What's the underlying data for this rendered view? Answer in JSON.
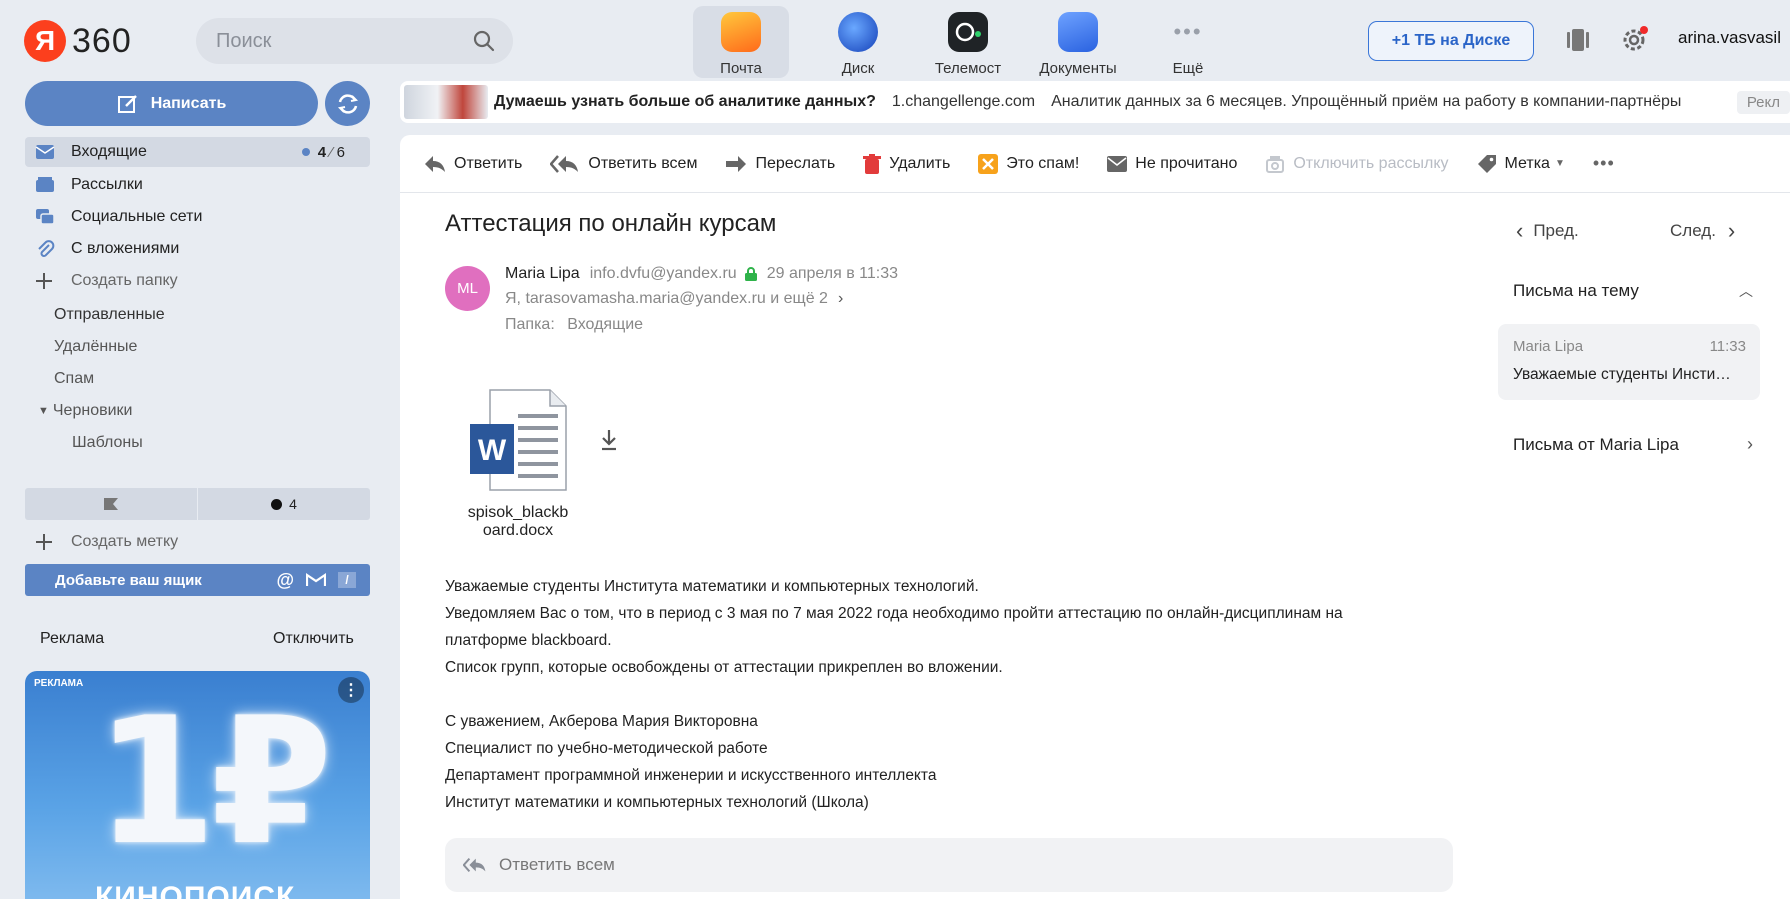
{
  "header": {
    "logo_letter": "Я",
    "logo_text": "360",
    "search_placeholder": "Поиск",
    "apps": [
      {
        "label": "Почта",
        "color": "#ff9f1a"
      },
      {
        "label": "Диск",
        "color": "#1e5bd8"
      },
      {
        "label": "Телемост",
        "color": "#1f2326"
      },
      {
        "label": "Документы",
        "color": "#3d7ef2"
      },
      {
        "label": "Ещё",
        "color": "#9aa0aa"
      }
    ],
    "storage_button": "+1 ТБ на Диске",
    "username": "arina.vasvasil"
  },
  "sidebar": {
    "compose_label": "Написать",
    "folders": [
      {
        "label": "Входящие",
        "count_unread": "4",
        "count_sep": "⁄",
        "count_total": "6"
      },
      {
        "label": "Рассылки"
      },
      {
        "label": "Социальные сети"
      },
      {
        "label": "С вложениями"
      },
      {
        "label": "Создать папку"
      }
    ],
    "subfolders": [
      "Отправленные",
      "Удалённые",
      "Спам",
      "Черновики",
      "Шаблоны"
    ],
    "labels_count": "4",
    "create_label": "Создать метку",
    "add_mailbox": "Добавьте ваш ящик",
    "ads_title": "Реклама",
    "ads_off": "Отключить",
    "ad_card_tag": "РЕКЛАМА",
    "ad_card_big": "1₽",
    "ad_card_text": "КИНОПОИСК"
  },
  "ad_banner": {
    "title": "Думаешь узнать больше об аналитике данных?",
    "domain": "1.changellenge.com",
    "text": "Аналитик данных за 6 месяцев. Упрощённый приём на работу в компании-партнёры",
    "tag": "Рекл"
  },
  "toolbar": {
    "reply": "Ответить",
    "reply_all": "Ответить всем",
    "forward": "Переслать",
    "delete": "Удалить",
    "spam": "Это спам!",
    "unread": "Не прочитано",
    "unsubscribe": "Отключить рассылку",
    "label": "Метка"
  },
  "message": {
    "subject": "Аттестация по онлайн курсам",
    "avatar_initials": "ML",
    "sender_name": "Maria Lipa",
    "sender_email": "info.dvfu@yandex.ru",
    "date": "29 апреля в 11:33",
    "recipients": "Я, tarasovamasha.maria@yandex.ru и ещё 2",
    "folder_label": "Папка:",
    "folder_value": "Входящие",
    "attachment_name_1": "spisok_blackb",
    "attachment_name_2": "oard.docx",
    "body": [
      "Уважаемые студенты Института математики и компьютерных технологий.",
      "Уведомляем Вас о том, что в период с 3 мая по 7 мая 2022 года необходимо пройти аттестацию по онлайн-дисциплинам на",
      "платформе blackboard.",
      "Список групп, которые освобождены от аттестации прикреплен во вложении.",
      "",
      "С уважением, Акберова Мария Викторовна",
      "Специалист по учебно-методической работе",
      "Департамент программной инженерии и искусственного интеллекта",
      "Институт математики и компьютерных технологий (Школа)"
    ],
    "reply_all_placeholder": "Ответить всем"
  },
  "right_panel": {
    "prev": "Пред.",
    "next": "След.",
    "thread_title": "Письма на тему",
    "thread_sender": "Maria Lipa",
    "thread_time": "11:33",
    "thread_snippet": "Уважаемые студенты Инсти…",
    "from_sender": "Письма от Maria Lipa"
  }
}
